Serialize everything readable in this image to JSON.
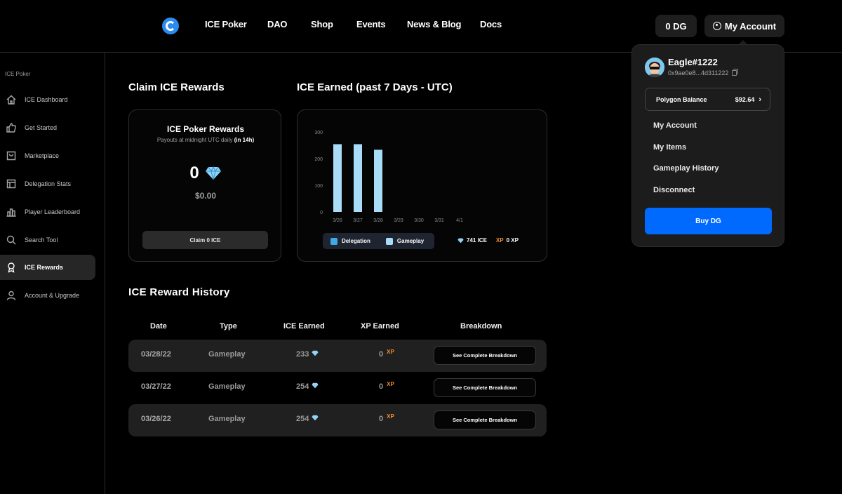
{
  "nav": {
    "links": [
      "ICE Poker",
      "DAO",
      "Shop",
      "Events",
      "News & Blog",
      "Docs"
    ],
    "dg_balance": "0 DG",
    "account_label": "My Account"
  },
  "sidebar": {
    "section": "ICE Poker",
    "items": [
      {
        "label": "ICE Dashboard",
        "icon": "home-icon"
      },
      {
        "label": "Get Started",
        "icon": "thumbs-up-icon"
      },
      {
        "label": "Marketplace",
        "icon": "bag-icon"
      },
      {
        "label": "Delegation Stats",
        "icon": "layout-icon"
      },
      {
        "label": "Player Leaderboard",
        "icon": "bar-chart-icon"
      },
      {
        "label": "Search Tool",
        "icon": "search-icon"
      },
      {
        "label": "ICE Rewards",
        "icon": "award-icon",
        "active": true
      },
      {
        "label": "Account & Upgrade",
        "icon": "user-icon"
      }
    ]
  },
  "claim": {
    "heading": "Claim ICE Rewards",
    "card_title": "ICE Poker Rewards",
    "subtitle": "Payouts at midnight UTC daily",
    "subtitle_bold": "(in 14h)",
    "amount": "0",
    "usd": "$0.00",
    "button": "Claim 0 ICE"
  },
  "earned": {
    "heading": "ICE Earned (past 7 Days - UTC)",
    "legend": [
      "Delegation",
      "Gameplay"
    ],
    "ice_total": "741 ICE",
    "xp_label": "XP",
    "xp_total": "0 XP"
  },
  "chart_data": {
    "type": "bar",
    "categories": [
      "3/26",
      "3/27",
      "3/28",
      "3/29",
      "3/30",
      "3/31",
      "4/1"
    ],
    "series": [
      {
        "name": "Delegation",
        "values": [
          0,
          0,
          0,
          0,
          0,
          0,
          0
        ]
      },
      {
        "name": "Gameplay",
        "values": [
          254,
          254,
          233,
          0,
          0,
          0,
          0
        ]
      }
    ],
    "yticks": [
      0,
      100,
      200,
      300
    ],
    "ylim": [
      0,
      300
    ],
    "colors": {
      "Delegation": "#3fa9e8",
      "Gameplay": "#a9ddf7"
    }
  },
  "history": {
    "heading": "ICE Reward History",
    "columns": [
      "Date",
      "Type",
      "ICE Earned",
      "XP Earned",
      "Breakdown"
    ],
    "rows": [
      {
        "date": "03/28/22",
        "type": "Gameplay",
        "ice": "233",
        "xp": "0",
        "xp_tag": "XP",
        "button": "See Complete Breakdown"
      },
      {
        "date": "03/27/22",
        "type": "Gameplay",
        "ice": "254",
        "xp": "0",
        "xp_tag": "XP",
        "button": "See Complete Breakdown"
      },
      {
        "date": "03/26/22",
        "type": "Gameplay",
        "ice": "254",
        "xp": "0",
        "xp_tag": "XP",
        "button": "See Complete Breakdown"
      }
    ]
  },
  "dropdown": {
    "username": "Eagle#1222",
    "address": "0x9ae0e8...4d311222",
    "balance_label": "Polygon Balance",
    "balance_value": "$92.64",
    "items": [
      "My Account",
      "My Items",
      "Gameplay History",
      "Disconnect"
    ],
    "buy_button": "Buy DG"
  },
  "colors": {
    "accent": "#006aff",
    "xp": "#f4922a",
    "ice": "#8fd3f7"
  }
}
